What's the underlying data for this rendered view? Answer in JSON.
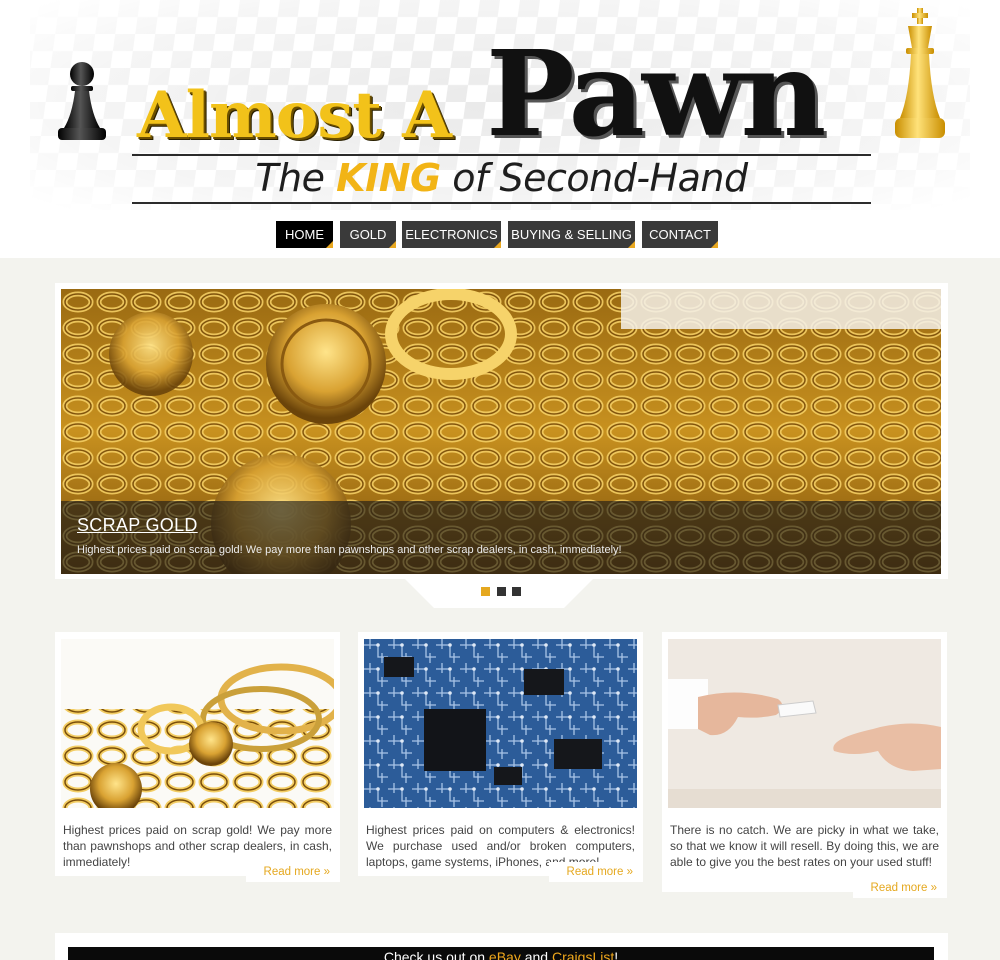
{
  "brand": {
    "name_left": "Almost A",
    "name_right": "Pawn",
    "tagline_before": "The",
    "tagline_highlight": "KING",
    "tagline_after": "of Second-Hand"
  },
  "nav": {
    "items": [
      {
        "label": "HOME",
        "active": true
      },
      {
        "label": "GOLD",
        "active": false
      },
      {
        "label": "ELECTRONICS",
        "active": false
      },
      {
        "label": "BUYING & SELLING",
        "active": false
      },
      {
        "label": "CONTACT",
        "active": false
      }
    ]
  },
  "slider": {
    "title": "SCRAP GOLD",
    "text": "Highest prices paid on scrap gold! We pay more than pawnshops and other scrap dealers, in cash, immediately!",
    "slide_count": 3,
    "active_slide": 1
  },
  "cards": [
    {
      "text": "Highest prices paid on scrap gold! We pay more than pawnshops and other scrap dealers, in cash, immediately!",
      "link": "Read more »"
    },
    {
      "text": "Highest prices paid on computers & electronics! We purchase used and/or broken computers, laptops, game systems, iPhones, and more!",
      "link": "Read more »"
    },
    {
      "text": "There is no catch. We are picky in what we take, so that we know it will resell. By doing this, we are able to give you the best rates on your used stuff!",
      "link": "Read more »"
    }
  ],
  "banner": {
    "prefix": "Check us out on ",
    "link1": "eBay",
    "middle": " and ",
    "link2": "CraigsList",
    "suffix": "!"
  },
  "colors": {
    "accent": "#e5a81f",
    "nav_bg": "#3a3a3a",
    "nav_active": "#000000",
    "page_bg": "#f3f3ee"
  },
  "icons": [
    "black-pawn-icon",
    "gold-king-icon"
  ]
}
